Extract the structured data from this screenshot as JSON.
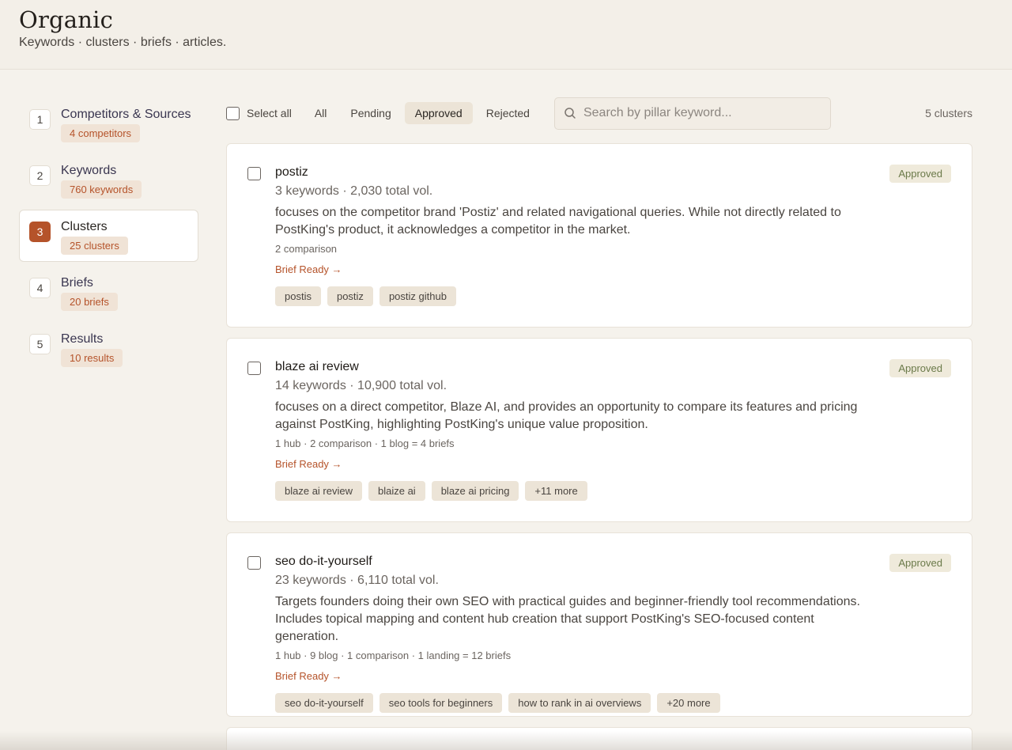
{
  "header": {
    "title": "Organic",
    "subtitle": "Keywords · clusters · briefs · articles."
  },
  "sidebar": {
    "steps": [
      {
        "num": "1",
        "label": "Competitors & Sources",
        "badge": "4 competitors"
      },
      {
        "num": "2",
        "label": "Keywords",
        "badge": "760 keywords"
      },
      {
        "num": "3",
        "label": "Clusters",
        "badge": "25 clusters"
      },
      {
        "num": "4",
        "label": "Briefs",
        "badge": "20 briefs"
      },
      {
        "num": "5",
        "label": "Results",
        "badge": "10 results"
      }
    ],
    "active_step": "3"
  },
  "toolbar": {
    "select_all_label": "Select all",
    "filters": [
      "All",
      "Pending",
      "Approved",
      "Rejected"
    ],
    "active_filter": "Approved",
    "search_placeholder": "Search by pillar keyword...",
    "search_value": "",
    "count_label": "5 clusters"
  },
  "clusters": [
    {
      "title": "postiz",
      "meta": "3 keywords · 2,030 total vol.",
      "description": "focuses on the competitor brand 'Postiz' and related navigational queries. While not directly related to PostKing's product, it acknowledges a competitor in the market.",
      "breakdown": "2 comparison",
      "brief_link": "Brief Ready →",
      "keywords": [
        "postis",
        "postiz",
        "postiz github"
      ],
      "status": "Approved"
    },
    {
      "title": "blaze ai review",
      "meta": "14 keywords · 10,900 total vol.",
      "description": "focuses on a direct competitor, Blaze AI, and provides an opportunity to compare its features and pricing against PostKing, highlighting PostKing's unique value proposition.",
      "breakdown": "1 hub · 2 comparison · 1 blog = 4 briefs",
      "brief_link": "Brief Ready →",
      "keywords": [
        "blaze ai review",
        "blaize ai",
        "blaze ai pricing",
        "+11 more"
      ],
      "status": "Approved"
    },
    {
      "title": "seo do-it-yourself",
      "meta": "23 keywords · 6,110 total vol.",
      "description": "Targets founders doing their own SEO with practical guides and beginner-friendly tool recommendations. Includes topical mapping and content hub creation that support PostKing's SEO-focused content generation.",
      "breakdown": "1 hub · 9 blog · 1 comparison · 1 landing = 12 briefs",
      "brief_link": "Brief Ready →",
      "keywords": [
        "seo do-it-yourself",
        "seo tools for beginners",
        "how to rank in ai overviews",
        "+20 more"
      ],
      "status": "Approved"
    }
  ]
}
